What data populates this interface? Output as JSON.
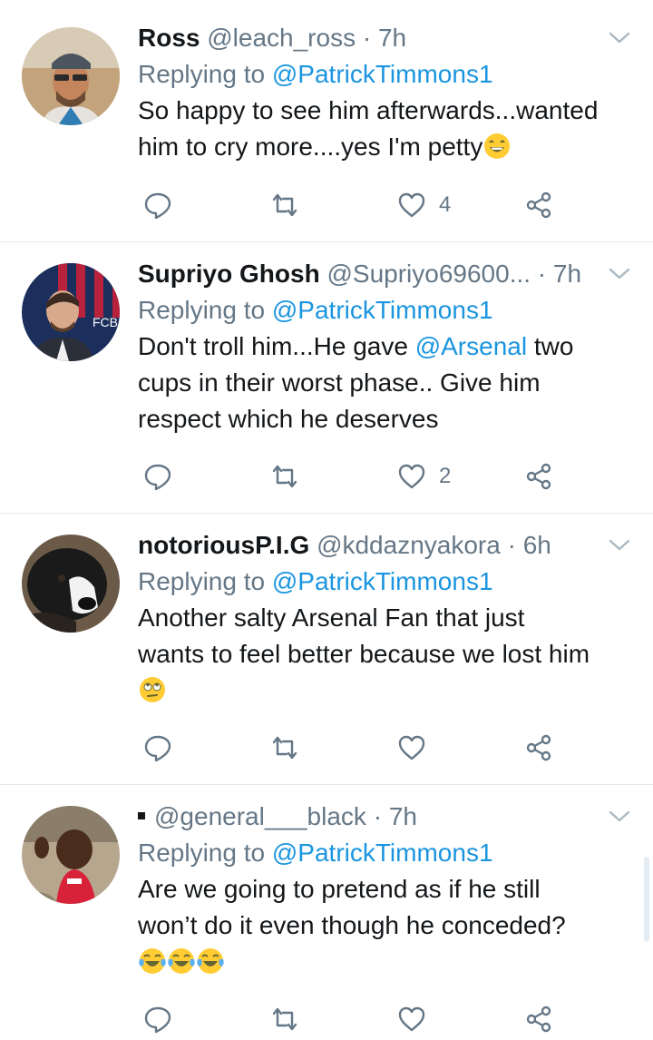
{
  "tweets": [
    {
      "name": "Ross",
      "handle": "@leach_ross",
      "sep": " · ",
      "time": "7h",
      "replying_prefix": "Replying to ",
      "replying_to": "@PatrickTimmons1",
      "text_1": "So happy to see him afterwards...wanted",
      "text_2": "him to cry more....yes I'm petty",
      "likes": "4"
    },
    {
      "name": "Supriyo Ghosh",
      "handle": "@Supriyo69600...",
      "sep": " · ",
      "time": "7h",
      "replying_prefix": "Replying to ",
      "replying_to": "@PatrickTimmons1",
      "text_1a": "Don't troll him...He gave ",
      "text_1_mention": "@Arsenal",
      "text_1b": " two",
      "text_2": "cups in their worst phase.. Give him",
      "text_3": "respect which he deserves",
      "likes": "2"
    },
    {
      "name": "notoriousP.I.G",
      "handle": "@kddaznyakora",
      "sep": " · ",
      "time": "6h",
      "replying_prefix": "Replying to ",
      "replying_to": "@PatrickTimmons1",
      "text_1": "Another salty Arsenal Fan that just",
      "text_2": "wants to feel better because we lost him",
      "likes": ""
    },
    {
      "name": "",
      "handle": "@general___black",
      "sep": " · ",
      "time": "7h",
      "replying_prefix": "Replying to ",
      "replying_to": "@PatrickTimmons1",
      "text_1": "Are we going to pretend as if he still",
      "text_2": "won’t do it even though he conceded?",
      "likes": ""
    }
  ],
  "icons": {
    "reply": "reply-icon",
    "retweet": "retweet-icon",
    "like": "heart-icon",
    "share": "share-icon",
    "caret": "chevron-down-icon"
  },
  "colors": {
    "link": "#1b95e0",
    "secondary_text": "#657786",
    "divider": "#e1e8ed"
  }
}
